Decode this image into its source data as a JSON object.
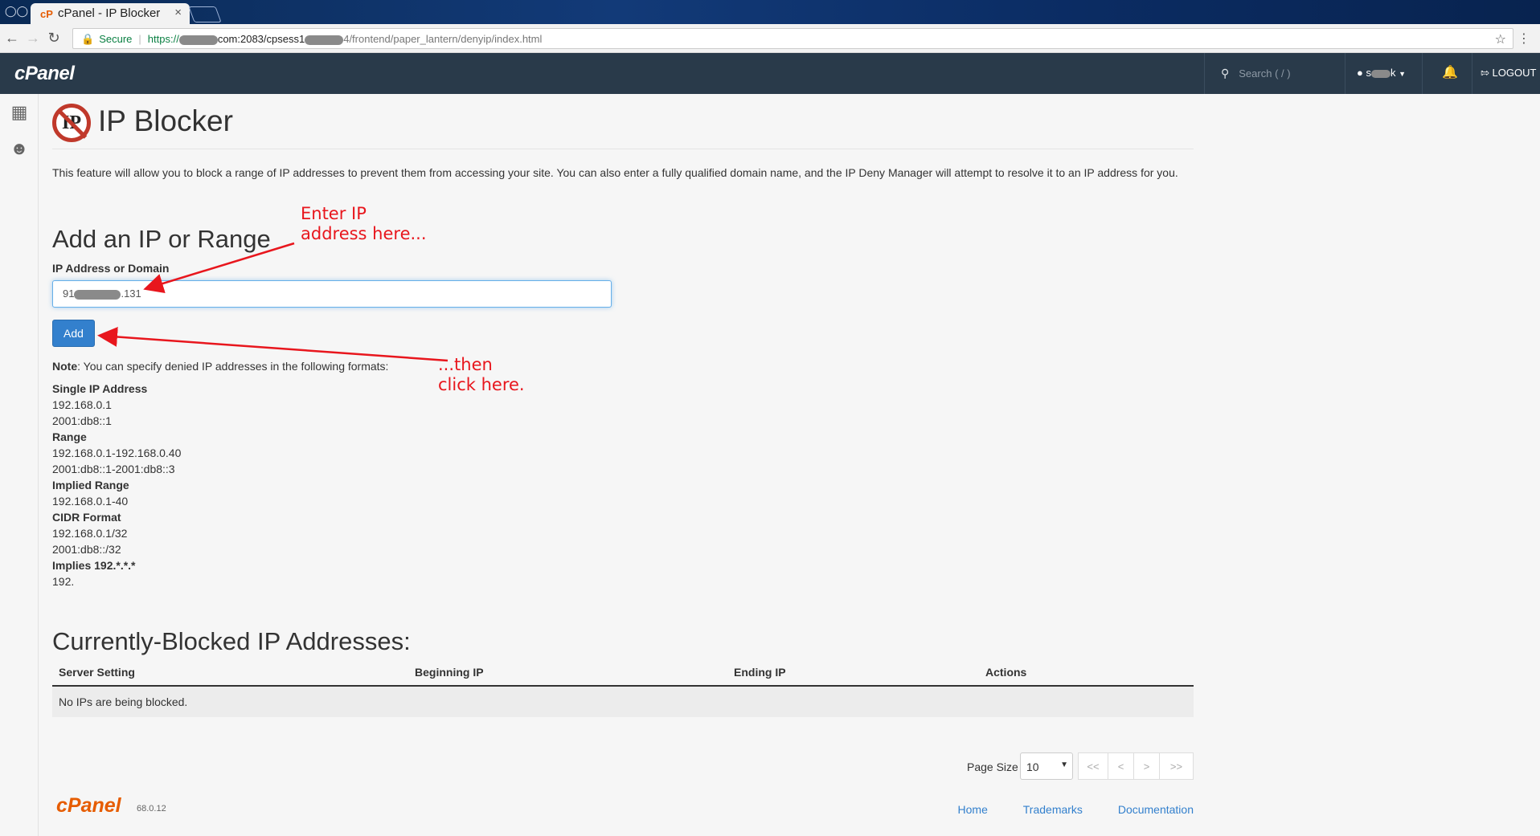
{
  "browser": {
    "tab_title": "cPanel - IP Blocker",
    "tab_close": "×",
    "secure_label": "Secure",
    "url_scheme": "https://",
    "url_host_visible": "com:2083/cpsess1",
    "url_path": "4/frontend/paper_lantern/denyip/index.html"
  },
  "topbar": {
    "logo": "cPanel",
    "search_placeholder": "Search ( / )",
    "user_visible": "s",
    "user_suffix": "k",
    "logout_label": "LOGOUT"
  },
  "page": {
    "title": "IP Blocker",
    "intro": "This feature will allow you to block a range of IP addresses to prevent them from accessing your site. You can also enter a fully qualified domain name, and the IP Deny Manager will attempt to resolve it to an IP address for you."
  },
  "add_form": {
    "heading": "Add an IP or Range",
    "field_label": "IP Address or Domain",
    "value_prefix": "91",
    "value_suffix": ".131",
    "button_label": "Add"
  },
  "note": {
    "bold": "Note",
    "text": ": You can specify denied IP addresses in the following formats:"
  },
  "formats": [
    {
      "heading": "Single IP Address",
      "examples": [
        "192.168.0.1",
        "2001:db8::1"
      ]
    },
    {
      "heading": "Range",
      "examples": [
        "192.168.0.1-192.168.0.40",
        "2001:db8::1-2001:db8::3"
      ]
    },
    {
      "heading": "Implied Range",
      "examples": [
        "192.168.0.1-40"
      ]
    },
    {
      "heading": "CIDR Format",
      "examples": [
        "192.168.0.1/32",
        "2001:db8::/32"
      ]
    },
    {
      "heading": "Implies 192.*.*.*",
      "examples": [
        "192."
      ]
    }
  ],
  "annotations": {
    "enter_line1": "Enter IP",
    "enter_line2": "address here...",
    "click_line1": "...then",
    "click_line2": "click here."
  },
  "blocked": {
    "heading": "Currently-Blocked IP Addresses:",
    "columns": [
      "Server Setting",
      "Beginning IP",
      "Ending IP",
      "Actions"
    ],
    "empty_message": "No IPs are being blocked."
  },
  "pager": {
    "page_size_label": "Page Size",
    "page_size_value": "10",
    "first": "<<",
    "prev": "<",
    "next": ">",
    "last": ">>"
  },
  "footer": {
    "logo": "cPanel",
    "version": "68.0.12",
    "links": [
      "Home",
      "Trademarks",
      "Documentation"
    ]
  },
  "colors": {
    "topbar": "#293a4a",
    "accent": "#3380cd",
    "annotation": "#e8161d",
    "brand_orange": "#e65c00"
  }
}
